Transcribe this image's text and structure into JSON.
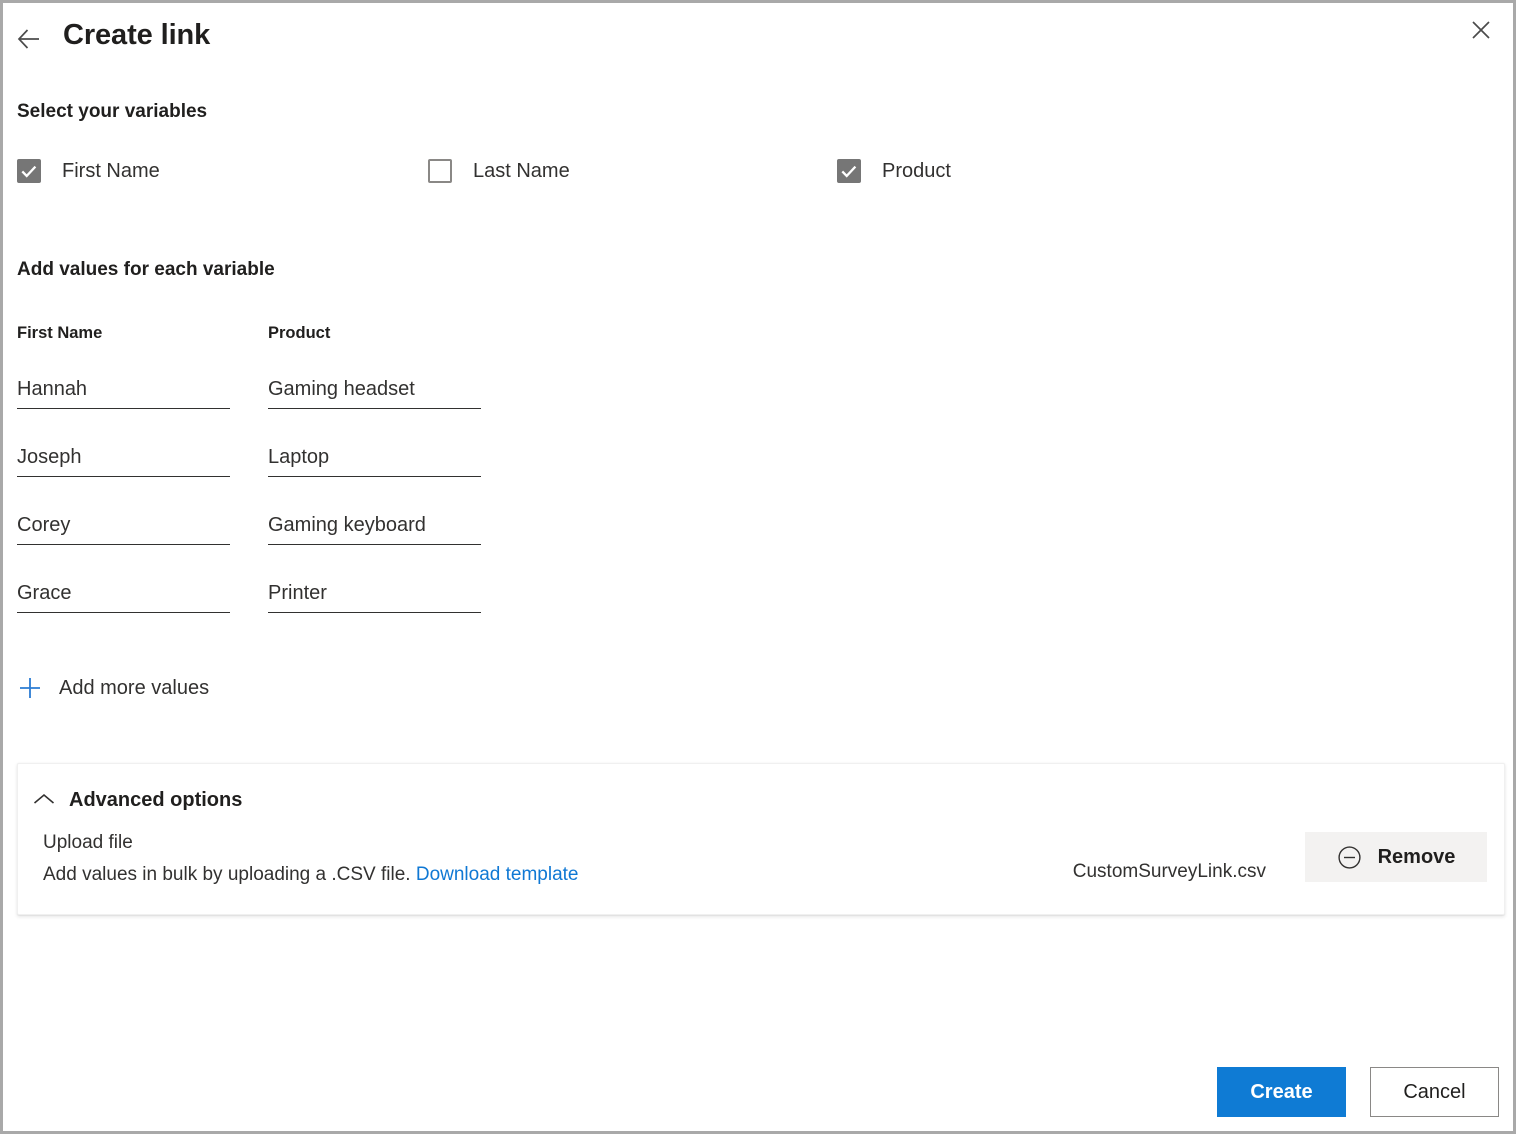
{
  "header": {
    "title": "Create link",
    "back_icon": "arrow-left-icon",
    "close_icon": "close-icon"
  },
  "variables_section": {
    "heading": "Select your variables",
    "options": [
      {
        "label": "First Name",
        "checked": true
      },
      {
        "label": "Last Name",
        "checked": false
      },
      {
        "label": "Product",
        "checked": true
      }
    ]
  },
  "values_section": {
    "heading": "Add values for each variable",
    "columns": [
      {
        "header": "First Name",
        "values": [
          "Hannah",
          "Joseph",
          "Corey",
          "Grace"
        ]
      },
      {
        "header": "Product",
        "values": [
          "Gaming headset",
          "Laptop",
          "Gaming keyboard",
          "Printer"
        ]
      }
    ],
    "add_more_label": "Add more values",
    "add_more_icon": "plus-icon"
  },
  "advanced_options": {
    "toggle_label": "Advanced options",
    "toggle_icon": "chevron-up-icon",
    "upload_title": "Upload file",
    "upload_desc": "Add values in bulk by uploading a .CSV file.",
    "download_link": "Download template",
    "file_name": "CustomSurveyLink.csv",
    "remove_label": "Remove",
    "remove_icon": "minus-circle-icon"
  },
  "footer": {
    "create_label": "Create",
    "cancel_label": "Cancel"
  },
  "colors": {
    "accent": "#0f7bd4",
    "link": "#0f78d4",
    "checkbox_checked": "#767676",
    "text_primary": "#201f1e",
    "text_secondary": "#323130",
    "button_neutral_bg": "#f3f2f1",
    "window_border": "#a9a9a9"
  }
}
